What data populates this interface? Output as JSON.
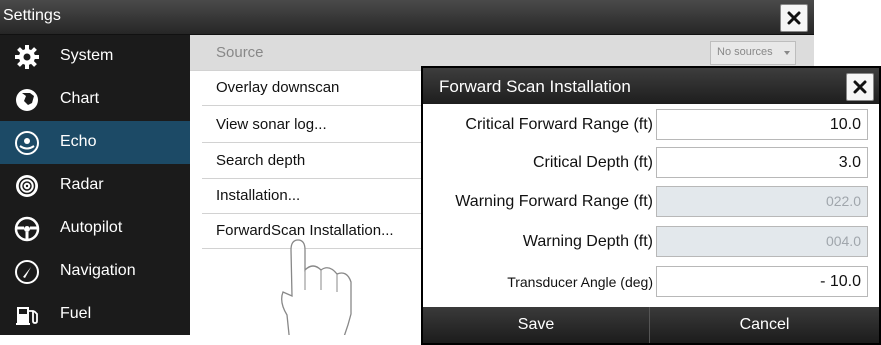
{
  "settings": {
    "title": "Settings",
    "close_icon": "close-icon"
  },
  "sidebar": {
    "items": [
      {
        "label": "System",
        "icon": "gear-icon",
        "active": false
      },
      {
        "label": "Chart",
        "icon": "chart-icon",
        "active": false
      },
      {
        "label": "Echo",
        "icon": "echo-icon",
        "active": true
      },
      {
        "label": "Radar",
        "icon": "radar-icon",
        "active": false
      },
      {
        "label": "Autopilot",
        "icon": "steering-wheel-icon",
        "active": false
      },
      {
        "label": "Navigation",
        "icon": "compass-icon",
        "active": false
      },
      {
        "label": "Fuel",
        "icon": "fuel-pump-icon",
        "active": false
      }
    ],
    "active_color": "#1c4a66"
  },
  "menu": {
    "source": {
      "label": "Source",
      "select_value": "No sources"
    },
    "items": [
      "Overlay downscan",
      "View sonar log...",
      "Search depth",
      "Installation...",
      "ForwardScan Installation..."
    ]
  },
  "dialog": {
    "title": "Forward Scan Installation",
    "fields": [
      {
        "label": "Critical Forward Range (ft)",
        "value": "10.0",
        "enabled": true
      },
      {
        "label": "Critical Depth (ft)",
        "value": "3.0",
        "enabled": true
      },
      {
        "label": "Warning Forward Range (ft)",
        "value": "022.0",
        "enabled": false
      },
      {
        "label": "Warning Depth (ft)",
        "value": "004.0",
        "enabled": false
      },
      {
        "label": "Transducer Angle (deg)",
        "value": "- 10.0",
        "enabled": true
      }
    ],
    "save_label": "Save",
    "cancel_label": "Cancel"
  }
}
